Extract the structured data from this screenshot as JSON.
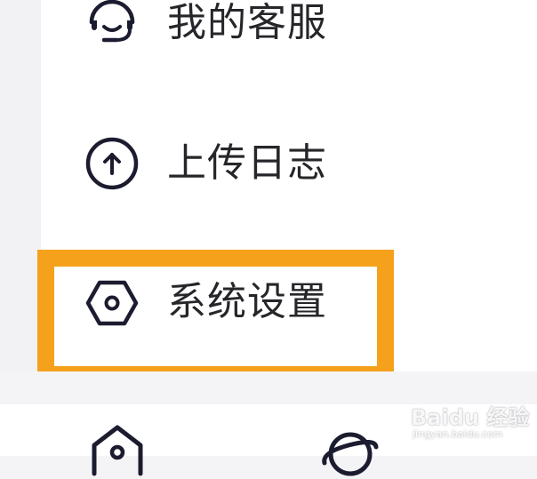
{
  "menu": {
    "items": [
      {
        "label": "我的客服",
        "icon": "headset-icon"
      },
      {
        "label": "上传日志",
        "icon": "upload-arrow-circle-icon"
      },
      {
        "label": "系统设置",
        "icon": "hexagon-settings-icon"
      }
    ]
  },
  "highlight": {
    "target": "系统设置",
    "color": "#f5a11c"
  },
  "bottom_nav": {
    "icons": [
      "home-icon",
      "planet-icon"
    ]
  },
  "colors": {
    "icon_stroke": "#1c1c30",
    "text": "#26262a",
    "background": "#f4f4f6"
  },
  "watermark": {
    "logo": "Baidu 经验",
    "url": "jingyan.baidu.com"
  }
}
